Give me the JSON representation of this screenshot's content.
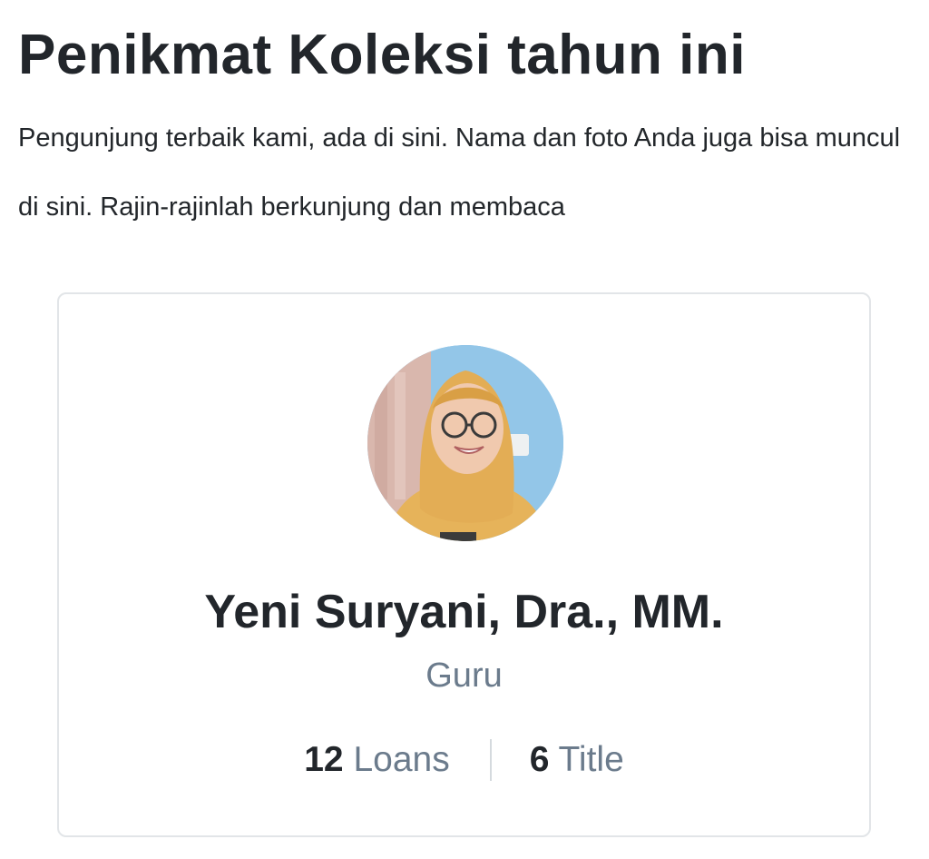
{
  "section": {
    "title": "Penikmat Koleksi tahun ini",
    "description": "Pengunjung terbaik kami, ada di sini. Nama dan foto Anda juga bisa muncul di sini. Rajin-rajinlah berkunjung dan membaca"
  },
  "member": {
    "photo_icon": "member-photo",
    "name": "Yeni Suryani, Dra., MM.",
    "role": "Guru",
    "loans_count": "12",
    "loans_label": "Loans",
    "titles_count": "6",
    "titles_label": "Title"
  },
  "colors": {
    "heading": "#22262b",
    "muted_text": "#6b7b8c",
    "card_border": "#e2e5e8",
    "divider": "#d5dade"
  }
}
